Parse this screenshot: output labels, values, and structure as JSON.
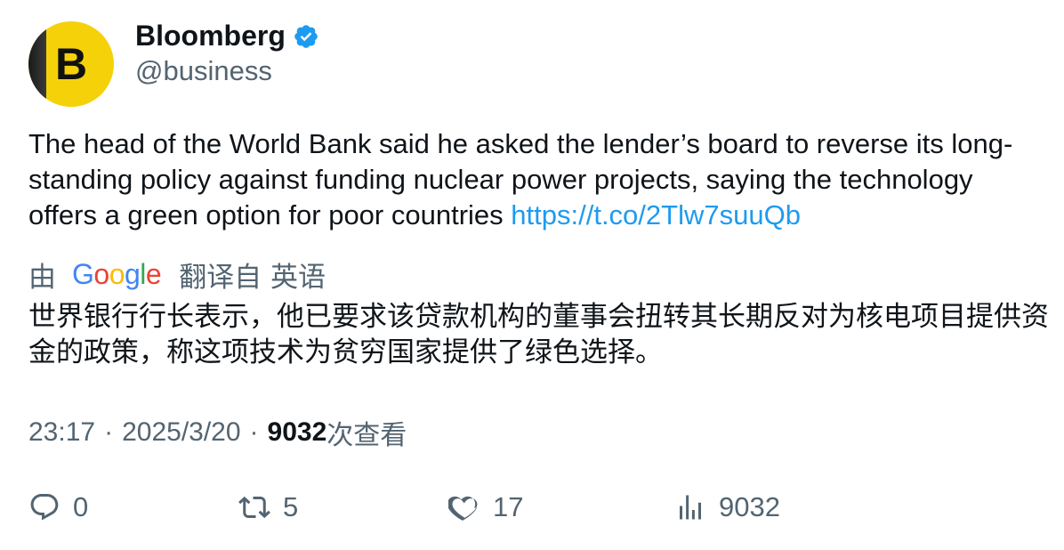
{
  "author": {
    "avatar_letter": "B",
    "name": "Bloomberg",
    "handle": "@business",
    "verified": true,
    "avatar_color": "#f5d10a"
  },
  "tweet": {
    "text": "The head of the World Bank said he asked the lender’s board to reverse its long-standing policy against funding nuclear power projects, saying the technology offers a green option for poor countries",
    "link": "https://t.co/2Tlw7suuQb"
  },
  "translation": {
    "prefix": "由",
    "provider": "Google",
    "suffix": "翻译自 英语",
    "text": "世界银行行长表示，他已要求该贷款机构的董事会扭转其长期反对为核电项目提供资金的政策，称这项技术为贫穷国家提供了绿色选择。"
  },
  "meta": {
    "time": "23:17",
    "sep1": "·",
    "date": "2025/3/20",
    "sep2": "·",
    "views_count": "9032",
    "views_label": "次查看"
  },
  "actions": {
    "replies": "0",
    "retweets": "5",
    "likes": "17",
    "views": "9032"
  },
  "colors": {
    "link": "#1d9bf0",
    "secondary_text": "#536471",
    "verified": "#1d9bf0"
  }
}
